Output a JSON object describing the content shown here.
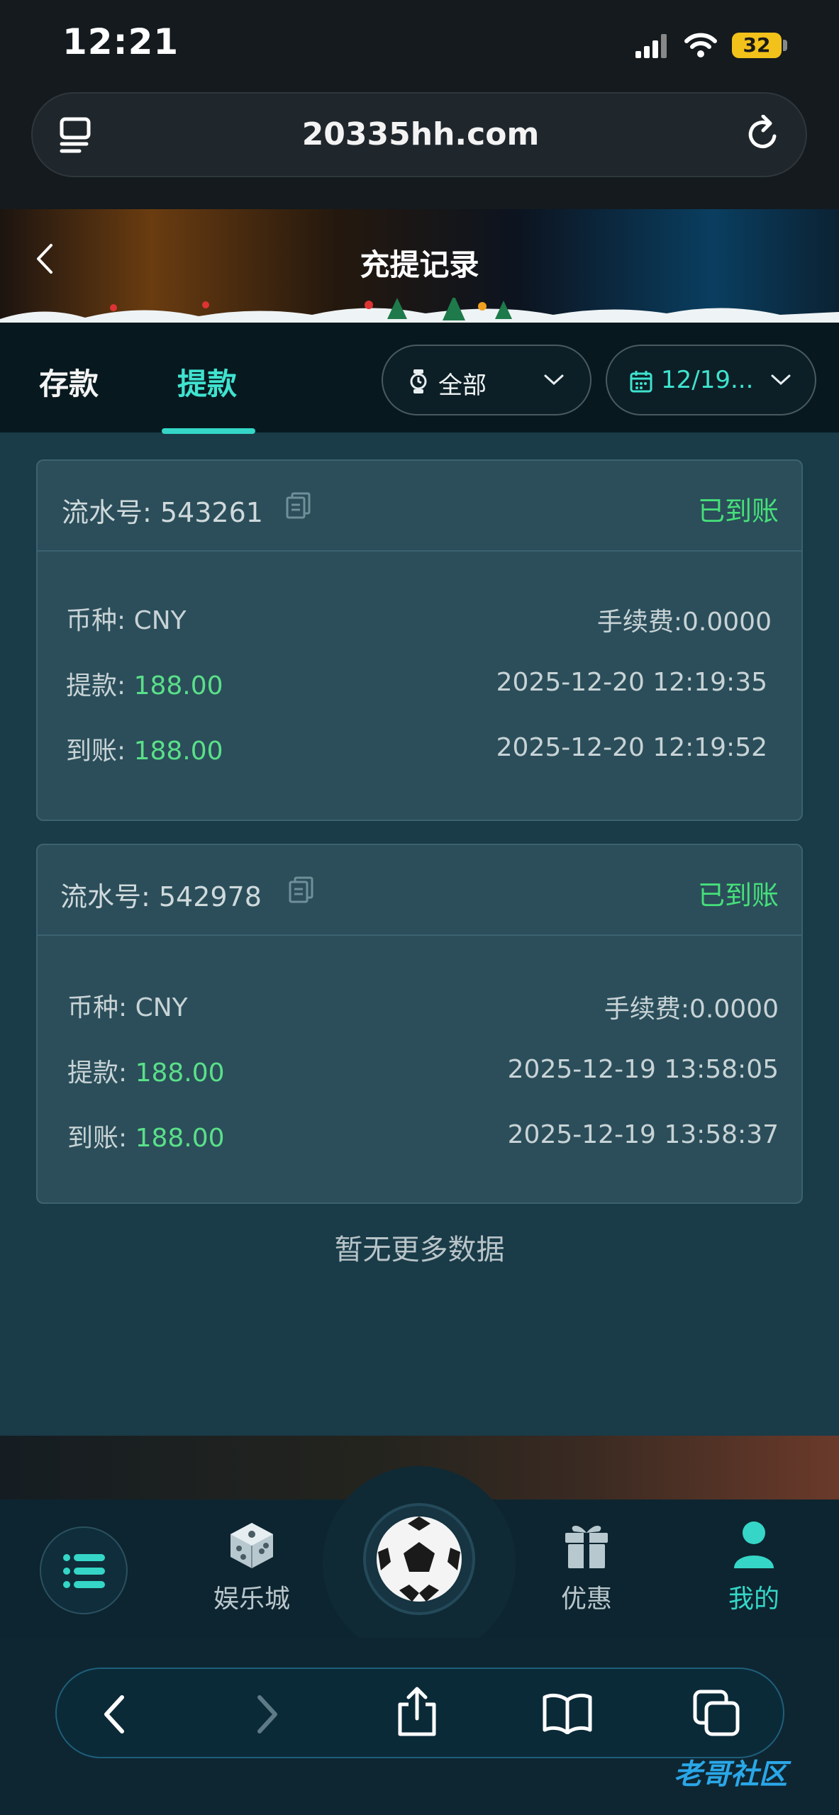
{
  "status_bar": {
    "time": "12:21",
    "battery": "32"
  },
  "browser": {
    "url": "20335hh.com"
  },
  "header": {
    "title": "充提记录"
  },
  "tabs": [
    {
      "label": "存款"
    },
    {
      "label": "提款"
    }
  ],
  "filters": {
    "status": "全部",
    "date": "12/19..."
  },
  "records": [
    {
      "serial_label": "流水号: 543261",
      "status": "已到账",
      "currency_label": "币种: ",
      "currency": "CNY",
      "fee": "手续费:0.0000",
      "withdraw_label": "提款: ",
      "withdraw_amount": "188.00",
      "withdraw_time": "2025-12-20 12:19:35",
      "arrive_label": "到账: ",
      "arrive_amount": "188.00",
      "arrive_time": "2025-12-20 12:19:52"
    },
    {
      "serial_label": "流水号: 542978",
      "status": "已到账",
      "currency_label": "币种: ",
      "currency": "CNY",
      "fee": "手续费:0.0000",
      "withdraw_label": "提款: ",
      "withdraw_amount": "188.00",
      "withdraw_time": "2025-12-19 13:58:05",
      "arrive_label": "到账: ",
      "arrive_amount": "188.00",
      "arrive_time": "2025-12-19 13:58:37"
    }
  ],
  "no_more": "暂无更多数据",
  "bottom_nav": [
    {
      "label": ""
    },
    {
      "label": "娱乐城"
    },
    {
      "label": ""
    },
    {
      "label": "优惠"
    },
    {
      "label": "我的"
    }
  ],
  "watermark": "老哥社区",
  "colors": {
    "accent": "#3fe3cf",
    "success": "#46e07a",
    "card": "#2b4e5a"
  }
}
